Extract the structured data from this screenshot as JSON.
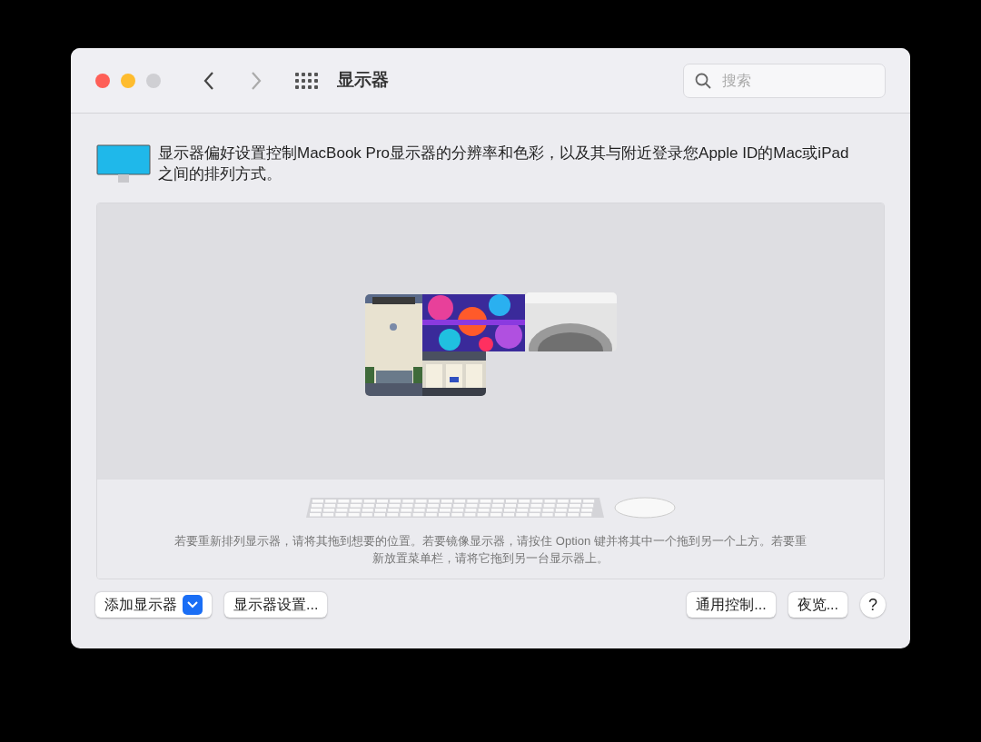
{
  "window": {
    "title": "显示器"
  },
  "search": {
    "placeholder": "搜索"
  },
  "description": "显示器偏好设置控制MacBook Pro显示器的分辨率和色彩，以及其与附近登录您Apple ID的Mac或iPad之间的排列方式。",
  "arrangement": {
    "hint": "若要重新排列显示器，请将其拖到想要的位置。若要镜像显示器，请按住 Option 键并将其中一个拖到另一个上方。若要重新放置菜单栏，请将它拖到另一台显示器上。"
  },
  "buttons_left": [
    {
      "label": "添加显示器",
      "kind": "dropdown"
    },
    {
      "label": "显示器设置..."
    }
  ],
  "buttons_right": [
    {
      "label": "通用控制..."
    },
    {
      "label": "夜览..."
    }
  ],
  "help": "?"
}
